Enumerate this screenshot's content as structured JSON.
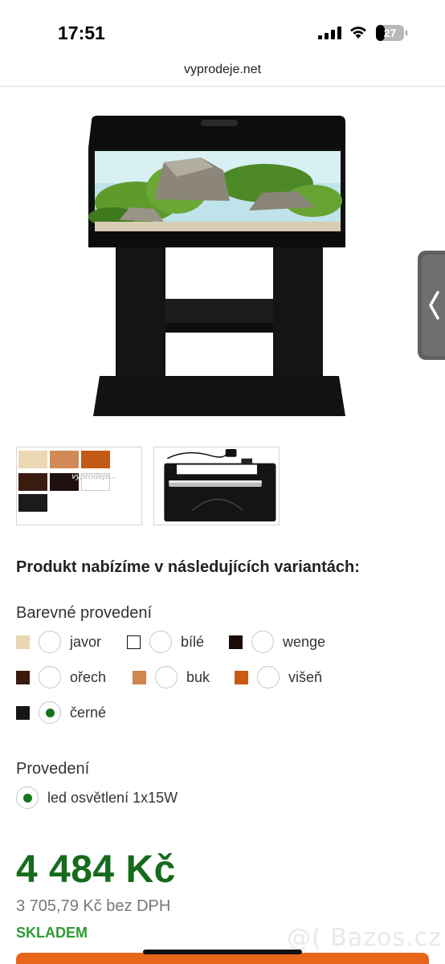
{
  "status": {
    "time": "17:51",
    "battery": "27"
  },
  "browser": {
    "url": "vyprodeje.net"
  },
  "thumbs": {
    "colors": [
      {
        "name": "javor",
        "color": "#ecd7b5"
      },
      {
        "name": "buk",
        "color": "#d18a56"
      },
      {
        "name": "višeň",
        "color": "#c25a16"
      },
      {
        "name": "ořech",
        "color": "#3a1b0f"
      },
      {
        "name": "wenge",
        "color": "#1f0f0d"
      },
      {
        "name": "bílé",
        "color": "#ffffff"
      },
      {
        "name": "černé",
        "color": "#1b1b1b"
      }
    ],
    "watermark": "vyprodeje..."
  },
  "variants": {
    "title": "Produkt nabízíme v následujících variantách:",
    "color_group": {
      "label": "Barevné provedení",
      "options": [
        {
          "label": "javor",
          "swatch": "#ead6b4",
          "selected": false
        },
        {
          "label": "bílé",
          "swatch": "#ffffff",
          "selected": false
        },
        {
          "label": "wenge",
          "swatch": "#1c0a08",
          "selected": false
        },
        {
          "label": "ořech",
          "swatch": "#3d1a10",
          "selected": false
        },
        {
          "label": "buk",
          "swatch": "#d08650",
          "selected": false
        },
        {
          "label": "višeň",
          "swatch": "#c85a14",
          "selected": false
        },
        {
          "label": "černé",
          "swatch": "#161616",
          "selected": true
        }
      ]
    },
    "type_group": {
      "label": "Provedení",
      "options": [
        {
          "label": "led osvětlení 1x15W",
          "selected": true
        }
      ]
    }
  },
  "price": {
    "main": "4 484 Kč",
    "net": "3 705,79 Kč bez DPH",
    "stock": "SKLADEM"
  },
  "overlay": {
    "watermark": "@( Bazos.cz"
  },
  "colors": {
    "accent_green": "#156b1c",
    "stock_green": "#2e9a35",
    "cta_orange": "#e8661a"
  }
}
